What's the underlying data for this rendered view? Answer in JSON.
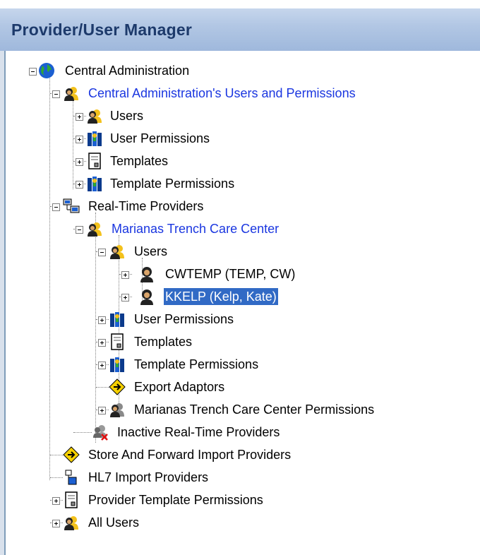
{
  "window": {
    "title": "Provider/User Manager"
  },
  "tree": {
    "central_admin": "Central Administration",
    "ca_users_perms": "Central Administration's Users and Permissions",
    "ca_users": "Users",
    "ca_user_permissions": "User Permissions",
    "ca_templates": "Templates",
    "ca_template_permissions": "Template Permissions",
    "rt_providers": "Real-Time Providers",
    "mtcc": "Marianas Trench Care Center",
    "mtcc_users": "Users",
    "user_cwtemp": "CWTEMP (TEMP, CW)",
    "user_kkelp": "KKELP (Kelp, Kate)",
    "mtcc_user_permissions": "User Permissions",
    "mtcc_templates": "Templates",
    "mtcc_template_permissions": "Template Permissions",
    "mtcc_export_adaptors": "Export Adaptors",
    "mtcc_permissions": "Marianas Trench Care Center Permissions",
    "inactive_rt": "Inactive Real-Time Providers",
    "store_forward": "Store And Forward Import Providers",
    "hl7": "HL7 Import Providers",
    "provider_template_permissions": "Provider Template Permissions",
    "all_users": "All Users"
  },
  "colors": {
    "selection": "#316ac5",
    "link_blue": "#1a36e0",
    "title_text": "#1d3a6b"
  },
  "icons": [
    "globe-icon",
    "users-icon",
    "permissions-book-icon",
    "template-document-icon",
    "network-computer-icon",
    "single-user-icon",
    "export-adaptor-icon",
    "inactive-users-icon",
    "hl7-icon"
  ]
}
